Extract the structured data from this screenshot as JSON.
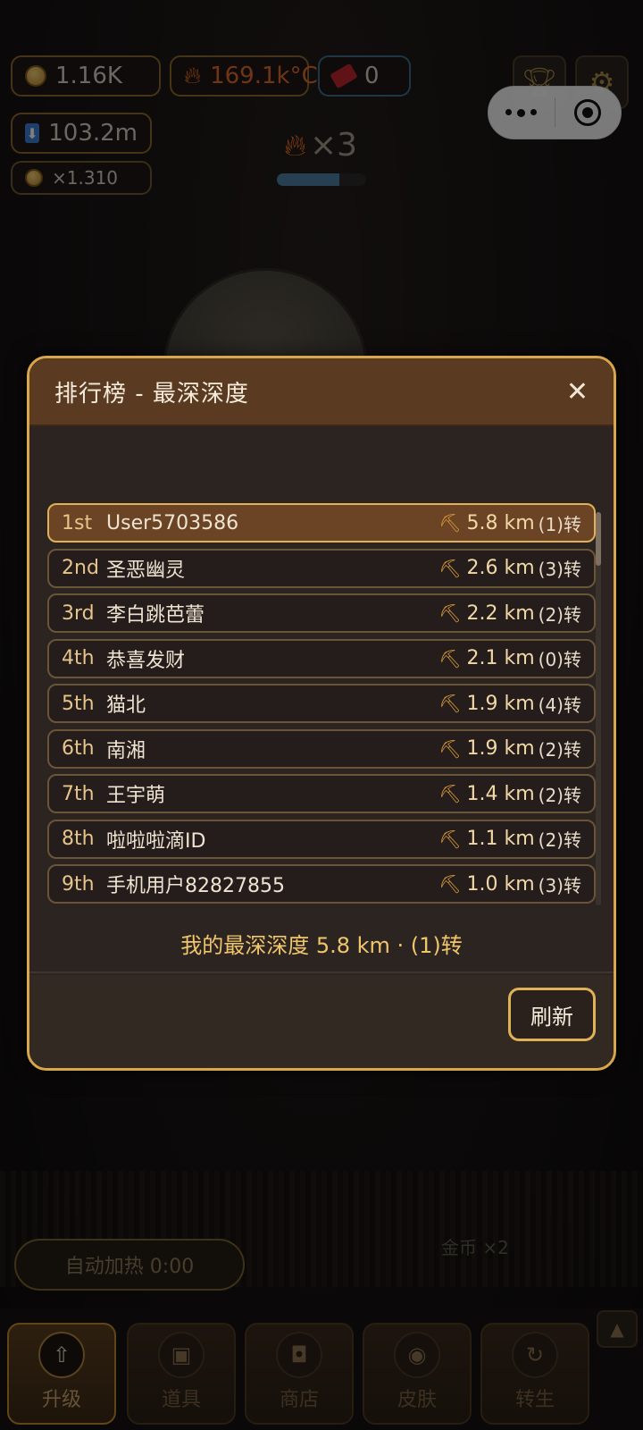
{
  "stats": {
    "coins": "1.16K",
    "temperature": "169.1k°C",
    "tickets": "0",
    "depth": "103.2m",
    "multiplier": "×1.310"
  },
  "combo": {
    "label": "×3",
    "progress": 0.7
  },
  "auto_heat_label": "自动加热 0:00",
  "coin_hint": "金币 ×2",
  "leaderboard": {
    "title": "排行榜 - 最深深度",
    "close_label": "✕",
    "rows": [
      {
        "rank": "1st",
        "name": "User5703586",
        "depth": "5.8 km",
        "turns": "(1)转"
      },
      {
        "rank": "2nd",
        "name": "圣恶幽灵",
        "depth": "2.6 km",
        "turns": "(3)转"
      },
      {
        "rank": "3rd",
        "name": "李白跳芭蕾",
        "depth": "2.2 km",
        "turns": "(2)转"
      },
      {
        "rank": "4th",
        "name": "恭喜发财",
        "depth": "2.1 km",
        "turns": "(0)转"
      },
      {
        "rank": "5th",
        "name": "猫北",
        "depth": "1.9 km",
        "turns": "(4)转"
      },
      {
        "rank": "6th",
        "name": "南湘",
        "depth": "1.9 km",
        "turns": "(2)转"
      },
      {
        "rank": "7th",
        "name": "王宇萌",
        "depth": "1.4 km",
        "turns": "(2)转"
      },
      {
        "rank": "8th",
        "name": "啦啦啦滴ID",
        "depth": "1.1 km",
        "turns": "(2)转"
      },
      {
        "rank": "9th",
        "name": "手机用户82827855",
        "depth": "1.0 km",
        "turns": "(3)转"
      }
    ],
    "my_depth": "我的最深深度 5.8 km · (1)转",
    "refresh_label": "刷新"
  },
  "tabs": [
    {
      "label": "升级",
      "icon": "upload-icon",
      "glyph": "⇧"
    },
    {
      "label": "道具",
      "icon": "chest-icon",
      "glyph": "▣"
    },
    {
      "label": "商店",
      "icon": "shopping-bag-icon",
      "glyph": "◘"
    },
    {
      "label": "皮肤",
      "icon": "palette-icon",
      "glyph": "◉"
    },
    {
      "label": "转生",
      "icon": "rebirth-icon",
      "glyph": "↻"
    }
  ],
  "colors": {
    "accent_gold": "#e0b158",
    "header_brown": "#5b3a22",
    "flame": "#ff7a1a"
  }
}
